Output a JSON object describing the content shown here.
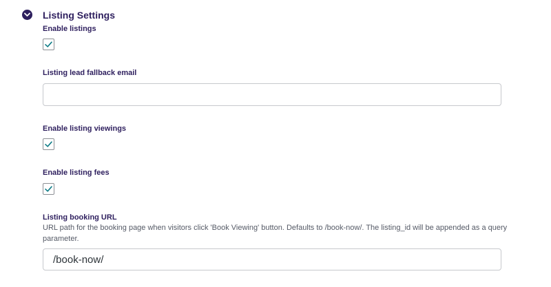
{
  "section": {
    "title": "Listing Settings",
    "toggle_icon": "chevron-down-icon",
    "accent_color": "#2e1f5e"
  },
  "fields": {
    "enable_listings": {
      "label": "Enable listings",
      "checked": true
    },
    "lead_fallback_email": {
      "label": "Listing lead fallback email",
      "value": ""
    },
    "enable_viewings": {
      "label": "Enable listing viewings",
      "checked": true
    },
    "enable_fees": {
      "label": "Enable listing fees",
      "checked": true
    },
    "booking_url": {
      "label": "Listing booking URL",
      "description": "URL path for the booking page when visitors click 'Book Viewing' button. Defaults to /book-now/. The listing_id will be appended as a query parameter.",
      "value": "/book-now/"
    }
  },
  "check_color": "#0e7c86"
}
